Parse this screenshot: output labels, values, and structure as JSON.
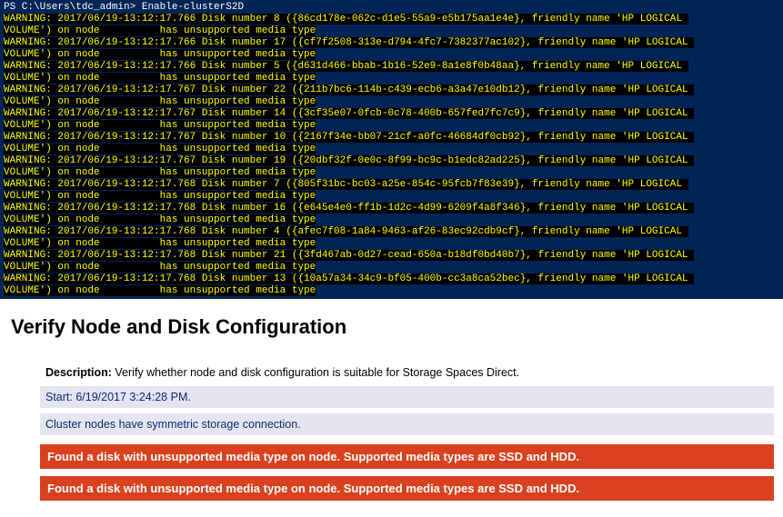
{
  "terminal": {
    "prompt_path": "PS C:\\Users\\tdc_admin>",
    "prompt_cmd": "Enable-clusterS2D",
    "warnings": [
      {
        "ts": "2017/06/19-13:12:17.766",
        "disk": "8",
        "guid": "{86cd178e-062c-d1e5-55a9-e5b175aa1e4e}",
        "fn": "HP LOGICAL"
      },
      {
        "ts": "2017/06/19-13:12:17.766",
        "disk": "17",
        "guid": "{cf7f2508-313e-d794-4fc7-7382377ac102}",
        "fn": "HP LOGICAL"
      },
      {
        "ts": "2017/06/19-13:12:17.766",
        "disk": "5",
        "guid": "{d631d466-bbab-1b16-52e9-8a1e8f0b48aa}",
        "fn": "HP LOGICAL"
      },
      {
        "ts": "2017/06/19-13:12:17.767",
        "disk": "22",
        "guid": "{211b7bc6-114b-c439-ecb6-a3a47e10db12}",
        "fn": "HP LOGICAL"
      },
      {
        "ts": "2017/06/19-13:12:17.767",
        "disk": "14",
        "guid": "{3cf35e07-0fcb-0c78-400b-657fed7fc7c9}",
        "fn": "HP LOGICAL"
      },
      {
        "ts": "2017/06/19-13:12:17.767",
        "disk": "10",
        "guid": "{2167f34e-bb07-21cf-a0fc-46684df0cb92}",
        "fn": "HP LOGICAL"
      },
      {
        "ts": "2017/06/19-13:12:17.767",
        "disk": "19",
        "guid": "{20dbf32f-0e0c-8f99-bc9c-b1edc82ad225}",
        "fn": "HP LOGICAL"
      },
      {
        "ts": "2017/06/19-13:12:17.768",
        "disk": "7",
        "guid": "{805f31bc-bc03-a25e-854c-95fcb7f83e39}",
        "fn": "HP LOGICAL"
      },
      {
        "ts": "2017/06/19-13:12:17.768",
        "disk": "16",
        "guid": "{e645e4e0-ff1b-1d2c-4d99-6209f4a8f346}",
        "fn": "HP LOGICAL"
      },
      {
        "ts": "2017/06/19-13:12:17.768",
        "disk": "4",
        "guid": "{afec7f08-1a84-9463-af26-83ec92cdb9cf}",
        "fn": "HP LOGICAL"
      },
      {
        "ts": "2017/06/19-13:12:17.768",
        "disk": "21",
        "guid": "{3fd467ab-0d27-cead-650a-b18df0bd40b7}",
        "fn": "HP LOGICAL"
      },
      {
        "ts": "2017/06/19-13:12:17.768",
        "disk": "13",
        "guid": "{10a57a34-34c9-bf05-400b-cc3a8ca52bec}",
        "fn": "HP LOGICAL"
      }
    ],
    "line2_a": "VOLUME') on node",
    "line2_b": "has unsupported media type"
  },
  "section": {
    "title": "Verify Node and Disk Configuration",
    "desc_label": "Description:",
    "desc_text": "Verify whether node and disk configuration is suitable for Storage Spaces Direct.",
    "start": "Start: 6/19/2017 3:24:28 PM.",
    "info": "Cluster nodes have symmetric storage connection.",
    "err1": "Found a disk with unsupported media type on node. Supported media types are SSD and HDD.",
    "err2": "Found a disk with unsupported media type on node. Supported media types are SSD and HDD."
  }
}
